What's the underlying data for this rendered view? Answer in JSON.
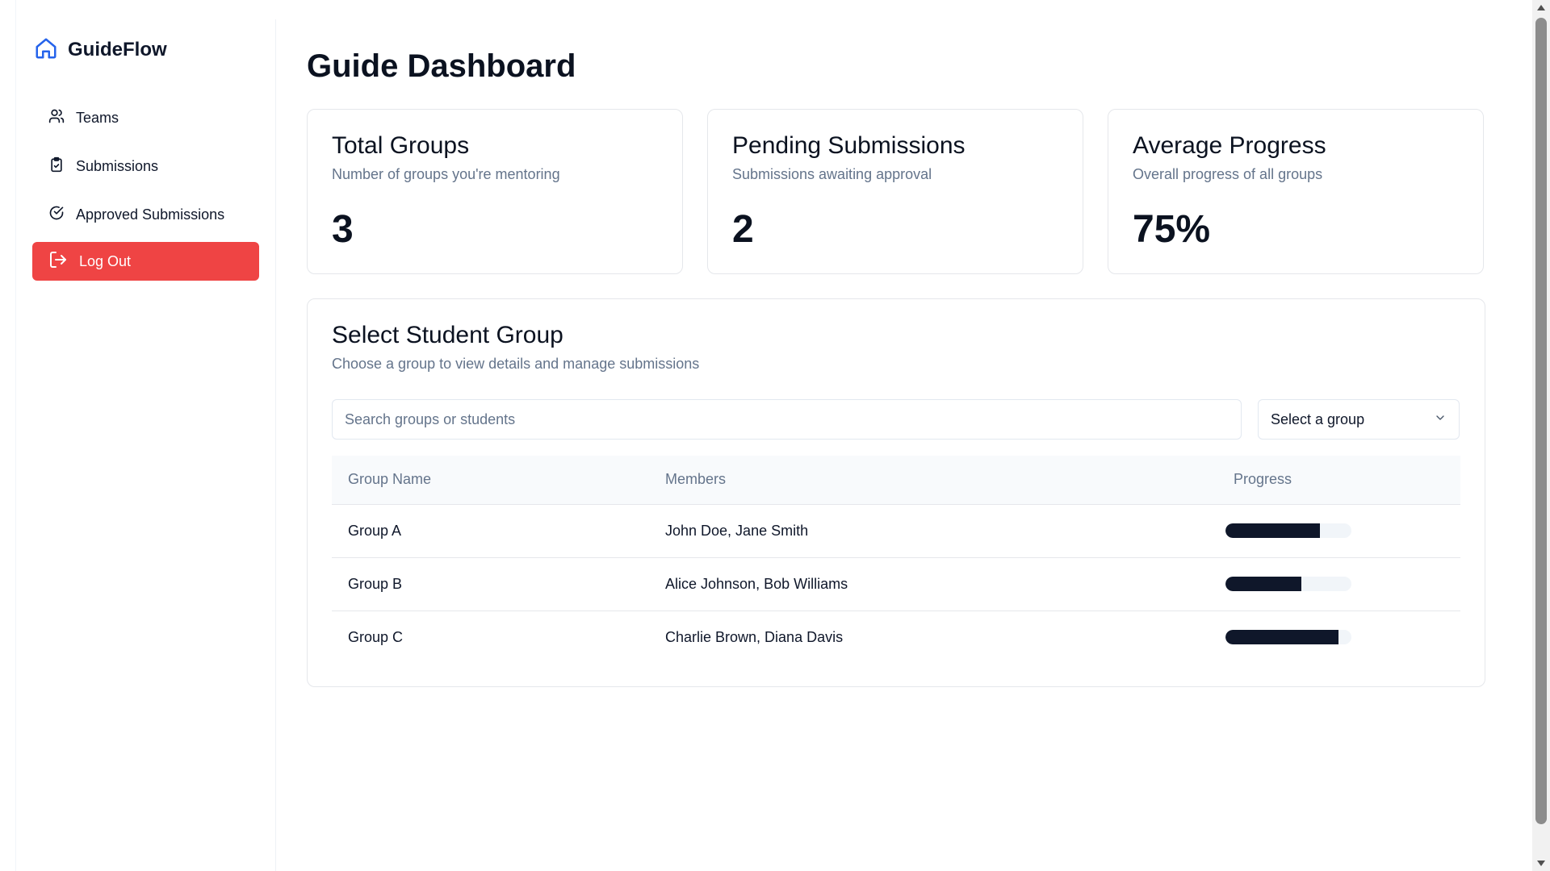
{
  "brand": {
    "name": "GuideFlow",
    "icon": "home-icon",
    "accent": "#2563eb"
  },
  "sidebar": {
    "items": [
      {
        "label": "Teams",
        "icon": "users-icon"
      },
      {
        "label": "Submissions",
        "icon": "clipboard-check-icon"
      },
      {
        "label": "Approved Submissions",
        "icon": "check-circle-icon"
      }
    ],
    "logout": {
      "label": "Log Out",
      "icon": "log-out-icon",
      "color": "#ef4444"
    }
  },
  "page": {
    "title": "Guide Dashboard"
  },
  "stats": [
    {
      "title": "Total Groups",
      "subtitle": "Number of groups you're mentoring",
      "value": "3"
    },
    {
      "title": "Pending Submissions",
      "subtitle": "Submissions awaiting approval",
      "value": "2"
    },
    {
      "title": "Average Progress",
      "subtitle": "Overall progress of all groups",
      "value": "75%"
    }
  ],
  "group_panel": {
    "title": "Select Student Group",
    "subtitle": "Choose a group to view details and manage submissions",
    "search_placeholder": "Search groups or students",
    "select_value": "Select a group",
    "columns": [
      "Group Name",
      "Members",
      "Progress"
    ],
    "rows": [
      {
        "name": "Group A",
        "members": "John Doe, Jane Smith",
        "progress": 75
      },
      {
        "name": "Group B",
        "members": "Alice Johnson, Bob Williams",
        "progress": 60
      },
      {
        "name": "Group C",
        "members": "Charlie Brown, Diana Davis",
        "progress": 90
      }
    ],
    "progress_color": "#0f172a"
  }
}
